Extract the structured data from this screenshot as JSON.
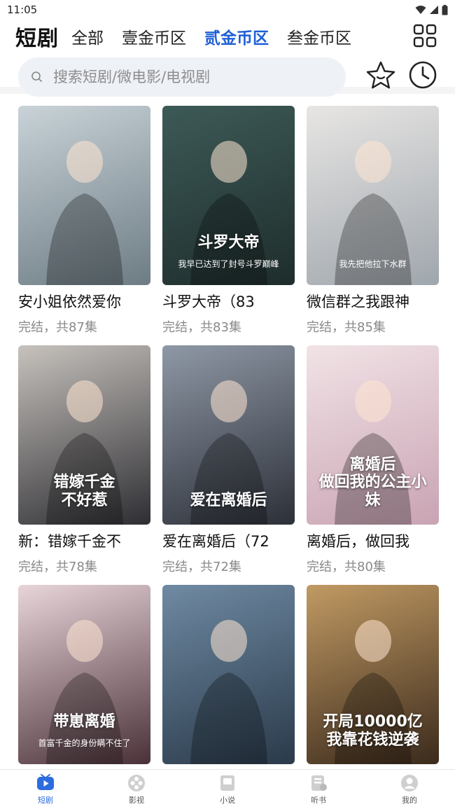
{
  "status": {
    "time": "11:05"
  },
  "header": {
    "brand": "短剧",
    "tabs": [
      {
        "label": "全部",
        "active": false
      },
      {
        "label": "壹金币区",
        "active": false
      },
      {
        "label": "贰金币区",
        "active": true
      },
      {
        "label": "叁金币区",
        "active": false
      }
    ]
  },
  "search": {
    "placeholder": "搜索短剧/微电影/电视剧"
  },
  "colors": {
    "accent": "#1f5fd6",
    "nav_active": "#2d6cdf",
    "search_bg": "#eef1f6"
  },
  "dramas": [
    {
      "title": "安小姐依然爱你",
      "status": "完结，共87集",
      "art": "",
      "palette": [
        "#c9d3d8",
        "#6d7c84"
      ]
    },
    {
      "title": "斗罗大帝（83",
      "status": "完结，共83集",
      "art": "斗罗大帝",
      "palette": [
        "#3d5a57",
        "#1e2d2c"
      ],
      "caption": "我早已达到了封号斗罗巅峰"
    },
    {
      "title": "微信群之我跟神",
      "status": "完结，共85集",
      "art": "",
      "palette": [
        "#e8e6e4",
        "#9fa6ad"
      ],
      "caption": "我先把他拉下水群"
    },
    {
      "title": "新：错嫁千金不",
      "status": "完结，共78集",
      "art": "错嫁千金\n不好惹",
      "palette": [
        "#c7c2bd",
        "#2e2e33"
      ]
    },
    {
      "title": "爱在离婚后（72",
      "status": "完结，共72集",
      "art": "爱在离婚后",
      "palette": [
        "#8f98a6",
        "#2c3038"
      ]
    },
    {
      "title": "离婚后，做回我",
      "status": "完结，共80集",
      "art": "离婚后\n做回我的公主小妹",
      "palette": [
        "#f1e3e6",
        "#c9a3b3"
      ]
    },
    {
      "title": "",
      "status": "",
      "art": "带崽离婚",
      "palette": [
        "#e8d5da",
        "#4a3138"
      ],
      "caption": "首富千金的身份瞒不住了"
    },
    {
      "title": "",
      "status": "",
      "art": "",
      "palette": [
        "#6f8aa3",
        "#2a3a4a"
      ]
    },
    {
      "title": "",
      "status": "",
      "art": "开局10000亿\n我靠花钱逆袭",
      "palette": [
        "#c19a63",
        "#3b2a1c"
      ]
    }
  ],
  "nav": [
    {
      "label": "短剧",
      "icon": "play-icon",
      "active": true
    },
    {
      "label": "影视",
      "icon": "film-reel-icon",
      "active": false
    },
    {
      "label": "小说",
      "icon": "book-icon",
      "active": false
    },
    {
      "label": "听书",
      "icon": "audiobook-icon",
      "active": false
    },
    {
      "label": "我的",
      "icon": "profile-icon",
      "active": false
    }
  ]
}
